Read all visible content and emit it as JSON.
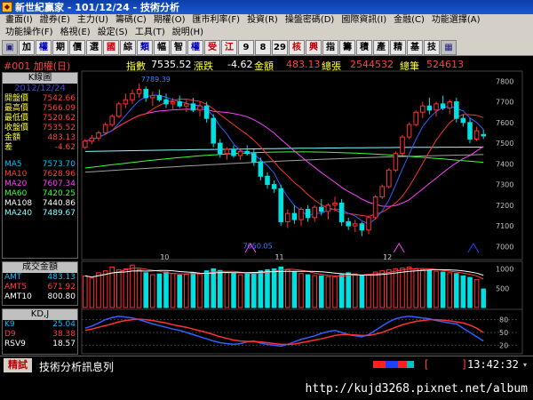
{
  "window": {
    "title": "新世紀贏家 - 101/12/24 - 技術分析"
  },
  "menu": [
    "畫面(I)",
    "證券(E)",
    "主力(U)",
    "籌碼(C)",
    "期權(O)",
    "匯市利率(F)",
    "投資(R)",
    "操盤密碼(D)",
    "國際資訊(I)",
    "金融(C)",
    "功能選擇(A)",
    "功能操作(F)",
    "格視(E)",
    "設定(S)",
    "工具(T)",
    "說明(H)"
  ],
  "toolbar": [
    "加",
    "權",
    "期",
    "價",
    "選",
    "國",
    "綜",
    "類",
    "幅",
    "智",
    "權",
    "受",
    "江",
    "9",
    "8",
    "29",
    "核",
    "興",
    "指",
    "籌",
    "積",
    "產",
    "精",
    "基",
    "技"
  ],
  "info": {
    "symbol": "#001 加權(日)",
    "index_label": "指數",
    "index_value": "7535.52",
    "change_label": "漲跌",
    "change_value": "-4.62",
    "amount_label": "金額",
    "amount_value": "483.13",
    "volume_label": "總張",
    "volume_value": "2544532",
    "count_label": "總筆",
    "count_value": "524613"
  },
  "kline_panel": {
    "title": "K線圖",
    "date": "2012/12/24",
    "rows": [
      {
        "label": "開盤價",
        "value": "7542.66"
      },
      {
        "label": "最高價",
        "value": "7566.09"
      },
      {
        "label": "最低價",
        "value": "7520.62"
      },
      {
        "label": "收盤價",
        "value": "7535.52"
      },
      {
        "label": "金額",
        "value": "483.13"
      },
      {
        "label": "差",
        "value": "-4.62"
      }
    ],
    "ma": [
      {
        "label": "MA5",
        "value": "7573.70",
        "color": "#00c0ff"
      },
      {
        "label": "MA10",
        "value": "7628.96",
        "color": "#ff4040"
      },
      {
        "label": "MA20",
        "value": "7607.34",
        "color": "#ff40ff"
      },
      {
        "label": "MA60",
        "value": "7420.25",
        "color": "#40ff40"
      },
      {
        "label": "MA108",
        "value": "7440.86",
        "color": "#ffffff"
      },
      {
        "label": "MA240",
        "value": "7489.67",
        "color": "#80ffff"
      }
    ]
  },
  "volume_panel": {
    "title": "成交金額",
    "rows": [
      {
        "label": "AMT",
        "value": "483.13",
        "color": "#00c0ff"
      },
      {
        "label": "AMT5",
        "value": "671.92",
        "color": "#ff4040"
      },
      {
        "label": "AMT10",
        "value": "800.80",
        "color": "#ffffff"
      }
    ]
  },
  "kd_panel": {
    "title": "KD,J",
    "rows": [
      {
        "label": "K9",
        "value": "25.04",
        "color": "#00c0ff"
      },
      {
        "label": "D9",
        "value": "38.38",
        "color": "#ff4040"
      },
      {
        "label": "RSV9",
        "value": "18.57",
        "color": "#ffffff"
      }
    ]
  },
  "chart_data": {
    "type": "candlestick",
    "price_axis": {
      "ticks": [
        "7800",
        "7700",
        "7600",
        "7500",
        "7400",
        "7300",
        "7200",
        "7100",
        "7000"
      ],
      "ylim": [
        6980,
        7840
      ]
    },
    "volume_axis": {
      "ticks": [
        "1000",
        "500"
      ]
    },
    "kd_axis": {
      "ticks": [
        "80",
        "50",
        "20"
      ]
    },
    "x_labels": [
      "10",
      "11",
      "12"
    ],
    "annotations": {
      "high": "7789.39",
      "low": "7050.05"
    },
    "colors": {
      "up": "#ff3030",
      "down": "#00e0e0",
      "ma5": "#3060ff",
      "ma10": "#ff3030",
      "ma20": "#ff40ff",
      "ma60": "#40ff40",
      "ma108": "#a0a0a0",
      "ma240": "#80ffff",
      "k": "#3060ff",
      "d": "#ff3030"
    },
    "candles": [
      [
        7480,
        7520,
        7470,
        7510
      ],
      [
        7510,
        7540,
        7495,
        7525
      ],
      [
        7525,
        7560,
        7510,
        7550
      ],
      [
        7550,
        7600,
        7540,
        7590
      ],
      [
        7590,
        7640,
        7580,
        7630
      ],
      [
        7630,
        7700,
        7620,
        7690
      ],
      [
        7690,
        7740,
        7670,
        7710
      ],
      [
        7710,
        7760,
        7690,
        7740
      ],
      [
        7740,
        7789,
        7720,
        7760
      ],
      [
        7760,
        7775,
        7700,
        7720
      ],
      [
        7720,
        7750,
        7680,
        7730
      ],
      [
        7730,
        7760,
        7700,
        7710
      ],
      [
        7710,
        7740,
        7670,
        7690
      ],
      [
        7690,
        7720,
        7660,
        7700
      ],
      [
        7700,
        7730,
        7670,
        7680
      ],
      [
        7680,
        7710,
        7650,
        7690
      ],
      [
        7690,
        7720,
        7650,
        7660
      ],
      [
        7660,
        7700,
        7630,
        7680
      ],
      [
        7680,
        7700,
        7600,
        7620
      ],
      [
        7620,
        7640,
        7480,
        7500
      ],
      [
        7500,
        7520,
        7430,
        7450
      ],
      [
        7450,
        7480,
        7420,
        7470
      ],
      [
        7470,
        7490,
        7430,
        7440
      ],
      [
        7440,
        7470,
        7420,
        7460
      ],
      [
        7460,
        7490,
        7440,
        7450
      ],
      [
        7450,
        7470,
        7390,
        7410
      ],
      [
        7410,
        7430,
        7320,
        7340
      ],
      [
        7340,
        7360,
        7280,
        7300
      ],
      [
        7300,
        7320,
        7260,
        7280
      ],
      [
        7280,
        7300,
        7100,
        7120
      ],
      [
        7120,
        7180,
        7090,
        7160
      ],
      [
        7160,
        7200,
        7110,
        7130
      ],
      [
        7130,
        7190,
        7100,
        7180
      ],
      [
        7180,
        7200,
        7120,
        7140
      ],
      [
        7140,
        7200,
        7120,
        7190
      ],
      [
        7190,
        7230,
        7150,
        7170
      ],
      [
        7170,
        7210,
        7130,
        7200
      ],
      [
        7200,
        7240,
        7170,
        7210
      ],
      [
        7210,
        7230,
        7100,
        7120
      ],
      [
        7120,
        7140,
        7080,
        7100
      ],
      [
        7100,
        7130,
        7070,
        7110
      ],
      [
        7110,
        7120,
        7050,
        7080
      ],
      [
        7080,
        7150,
        7060,
        7140
      ],
      [
        7140,
        7250,
        7130,
        7240
      ],
      [
        7240,
        7300,
        7230,
        7290
      ],
      [
        7290,
        7380,
        7280,
        7370
      ],
      [
        7370,
        7460,
        7360,
        7450
      ],
      [
        7450,
        7540,
        7440,
        7530
      ],
      [
        7530,
        7600,
        7520,
        7590
      ],
      [
        7590,
        7660,
        7580,
        7650
      ],
      [
        7650,
        7700,
        7620,
        7680
      ],
      [
        7680,
        7720,
        7640,
        7660
      ],
      [
        7660,
        7700,
        7630,
        7690
      ],
      [
        7690,
        7730,
        7660,
        7670
      ],
      [
        7670,
        7710,
        7640,
        7700
      ],
      [
        7700,
        7720,
        7600,
        7620
      ],
      [
        7620,
        7640,
        7580,
        7600
      ],
      [
        7600,
        7620,
        7500,
        7520
      ],
      [
        7520,
        7580,
        7510,
        7560
      ],
      [
        7542,
        7566,
        7520,
        7535
      ]
    ],
    "volume": [
      820,
      760,
      900,
      950,
      1050,
      980,
      1000,
      1100,
      980,
      900,
      850,
      870,
      920,
      880,
      840,
      860,
      900,
      880,
      950,
      1000,
      960,
      900,
      880,
      850,
      870,
      900,
      950,
      980,
      1000,
      1050,
      980,
      920,
      880,
      850,
      830,
      820,
      800,
      790,
      850,
      900,
      870,
      820,
      860,
      920,
      950,
      980,
      1000,
      1020,
      1050,
      1000,
      980,
      960,
      940,
      920,
      900,
      880,
      820,
      780,
      720,
      480
    ],
    "k": [
      60,
      65,
      72,
      80,
      85,
      88,
      86,
      84,
      80,
      75,
      70,
      66,
      62,
      58,
      55,
      50,
      45,
      40,
      35,
      30,
      26,
      24,
      22,
      24,
      28,
      30,
      25,
      22,
      20,
      18,
      22,
      28,
      34,
      38,
      42,
      48,
      52,
      55,
      50,
      45,
      42,
      40,
      45,
      55,
      65,
      75,
      82,
      86,
      88,
      86,
      84,
      82,
      78,
      75,
      72,
      70,
      60,
      50,
      40,
      30
    ],
    "d": [
      55,
      58,
      62,
      66,
      70,
      75,
      78,
      80,
      81,
      80,
      78,
      75,
      72,
      68,
      65,
      62,
      58,
      54,
      50,
      45,
      40,
      36,
      32,
      30,
      29,
      29,
      28,
      26,
      24,
      22,
      22,
      23,
      26,
      29,
      32,
      35,
      39,
      43,
      45,
      45,
      44,
      43,
      43,
      46,
      50,
      56,
      62,
      68,
      72,
      76,
      78,
      80,
      80,
      79,
      77,
      75,
      72,
      67,
      60,
      50
    ]
  }
}
